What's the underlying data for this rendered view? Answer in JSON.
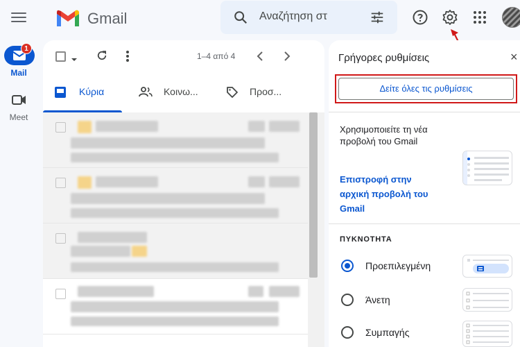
{
  "app": {
    "name": "Gmail"
  },
  "search": {
    "placeholder": "Αναζήτηση στ"
  },
  "rail": {
    "mail_label": "Mail",
    "mail_badge": "1",
    "meet_label": "Meet"
  },
  "toolbar": {
    "pager": "1–4 από 4"
  },
  "tabs": [
    {
      "label": "Κύρια",
      "active": true
    },
    {
      "label": "Κοινω...",
      "active": false
    },
    {
      "label": "Προσ...",
      "active": false
    }
  ],
  "quick_settings": {
    "title": "Γρήγορες ρυθμίσεις",
    "close": "×",
    "see_all": "Δείτε όλες τις ρυθμίσεις",
    "new_view_text": "Χρησιμοποιείτε τη νέα προβολή του Gmail",
    "revert_link": "Επιστροφή στην αρχική προβολή του Gmail",
    "density_heading": "ΠΥΚΝΟΤΗΤΑ",
    "density_options": [
      {
        "label": "Προεπιλεγμένη",
        "selected": true
      },
      {
        "label": "Άνετη",
        "selected": false
      },
      {
        "label": "Συμπαγής",
        "selected": false
      }
    ]
  },
  "colors": {
    "accent": "#0b57d0",
    "highlight_box": "#d01818",
    "badge": "#d93025"
  }
}
